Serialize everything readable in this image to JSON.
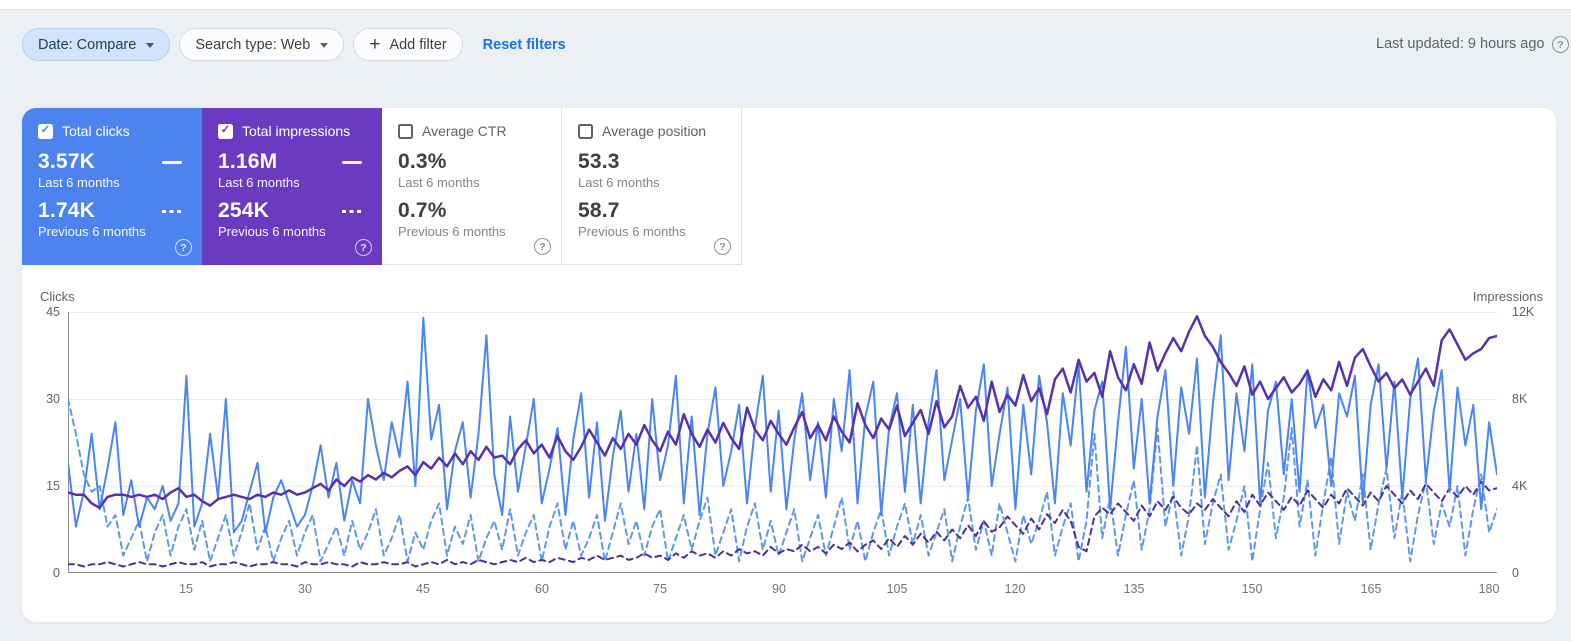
{
  "toolbar": {
    "date_filter": "Date: Compare",
    "search_type_filter": "Search type: Web",
    "add_filter_label": "Add filter",
    "reset_filters_label": "Reset filters",
    "last_updated": "Last updated: 9 hours ago",
    "help_icon_glyph": "?"
  },
  "metrics": [
    {
      "label": "Total clicks",
      "checked": true,
      "color": "#4c83ee",
      "current": {
        "value": "3.57K",
        "period": "Last 6 months"
      },
      "previous": {
        "value": "1.74K",
        "period": "Previous 6 months"
      }
    },
    {
      "label": "Total impressions",
      "checked": true,
      "color": "#6a3bc0",
      "current": {
        "value": "1.16M",
        "period": "Last 6 months"
      },
      "previous": {
        "value": "254K",
        "period": "Previous 6 months"
      }
    },
    {
      "label": "Average CTR",
      "checked": false,
      "color": null,
      "current": {
        "value": "0.3%",
        "period": "Last 6 months"
      },
      "previous": {
        "value": "0.7%",
        "period": "Previous 6 months"
      }
    },
    {
      "label": "Average position",
      "checked": false,
      "color": null,
      "current": {
        "value": "53.3",
        "period": "Last 6 months"
      },
      "previous": {
        "value": "58.7",
        "period": "Previous 6 months"
      }
    }
  ],
  "chart_data": {
    "type": "line",
    "x": "day index (last ~182 days, values approximated from pixels)",
    "x_tick_labels": [
      15,
      30,
      45,
      60,
      75,
      90,
      105,
      120,
      135,
      150,
      165,
      180
    ],
    "axes": {
      "left": {
        "label": "Clicks",
        "max": 45,
        "tick_labels": [
          "45",
          "30",
          "15",
          "0"
        ]
      },
      "right": {
        "label": "Impressions",
        "max": 12,
        "unit": "K",
        "tick_labels": [
          "12K",
          "8K",
          "4K",
          "0"
        ]
      }
    },
    "grid": true,
    "series": [
      {
        "name": "Clicks — Last 6 months",
        "axis": "left",
        "style": "solid",
        "color": "#4a85f0",
        "width": 2,
        "values": [
          19,
          8,
          14,
          24,
          11,
          18,
          26,
          10,
          16,
          8,
          13,
          11,
          15,
          9,
          12,
          34,
          8,
          12,
          24,
          13,
          30,
          7,
          9,
          14,
          19,
          7,
          13,
          16,
          12,
          8,
          10,
          15,
          22,
          13,
          19,
          9,
          16,
          12,
          30,
          22,
          16,
          26,
          20,
          33,
          15,
          44,
          23,
          29,
          11,
          21,
          26,
          13,
          24,
          41,
          17,
          10,
          27,
          14,
          22,
          30,
          12,
          18,
          25,
          10,
          23,
          31,
          13,
          26,
          9,
          20,
          28,
          14,
          24,
          11,
          30,
          16,
          22,
          34,
          12,
          27,
          10,
          24,
          32,
          15,
          21,
          29,
          12,
          25,
          34,
          14,
          28,
          11,
          23,
          31,
          16,
          26,
          13,
          30,
          21,
          35,
          12,
          27,
          33,
          10,
          25,
          31,
          14,
          29,
          12,
          26,
          35,
          16,
          23,
          30,
          13,
          28,
          36,
          15,
          24,
          32,
          11,
          29,
          17,
          34,
          26,
          12,
          31,
          22,
          36,
          14,
          28,
          33,
          11,
          26,
          39,
          18,
          30,
          12,
          27,
          35,
          15,
          32,
          24,
          37,
          13,
          29,
          41,
          16,
          31,
          21,
          36,
          12,
          28,
          33,
          17,
          30,
          14,
          35,
          25,
          29,
          15,
          31,
          27,
          34,
          12,
          29,
          36,
          18,
          33,
          13,
          30,
          37,
          16,
          28,
          35,
          14,
          32,
          22,
          29,
          11,
          26,
          17
        ]
      },
      {
        "name": "Clicks — Previous 6 months",
        "axis": "left",
        "style": "dashed",
        "color": "#5e97ee",
        "width": 2,
        "values": [
          30,
          24,
          17,
          14,
          15,
          8,
          10,
          3,
          6,
          9,
          2,
          7,
          10,
          3,
          8,
          11,
          4,
          9,
          2,
          6,
          10,
          3,
          7,
          12,
          4,
          8,
          2,
          6,
          9,
          3,
          7,
          10,
          2,
          5,
          8,
          3,
          9,
          4,
          7,
          11,
          3,
          6,
          10,
          2,
          7,
          4,
          9,
          12,
          3,
          8,
          5,
          10,
          2,
          6,
          9,
          4,
          11,
          3,
          7,
          10,
          2,
          8,
          12,
          4,
          9,
          3,
          6,
          10,
          2,
          7,
          12,
          5,
          9,
          3,
          8,
          11,
          2,
          6,
          10,
          4,
          9,
          13,
          3,
          7,
          11,
          2,
          8,
          12,
          4,
          9,
          3,
          7,
          11,
          2,
          6,
          10,
          3,
          8,
          13,
          4,
          9,
          2,
          7,
          11,
          3,
          8,
          12,
          5,
          10,
          3,
          7,
          11,
          2,
          8,
          13,
          4,
          9,
          3,
          12,
          7,
          2,
          10,
          5,
          9,
          14,
          3,
          8,
          12,
          2,
          9,
          24,
          6,
          13,
          3,
          10,
          16,
          4,
          11,
          25,
          8,
          14,
          3,
          10,
          22,
          5,
          12,
          17,
          4,
          9,
          15,
          2,
          11,
          19,
          6,
          13,
          25,
          8,
          16,
          3,
          12,
          20,
          5,
          14,
          9,
          17,
          4,
          12,
          18,
          6,
          14,
          2,
          10,
          16,
          5,
          12,
          8,
          15,
          3,
          11,
          17,
          7,
          11
        ]
      },
      {
        "name": "Impressions — Last 6 months",
        "axis": "right",
        "style": "solid",
        "color": "#5732af",
        "width": 2.5,
        "values": [
          3.7,
          3.6,
          3.6,
          3.2,
          3.0,
          3.5,
          3.6,
          3.6,
          3.5,
          3.6,
          3.5,
          3.6,
          3.4,
          3.7,
          3.9,
          3.5,
          3.6,
          3.3,
          3.1,
          3.4,
          3.5,
          3.6,
          3.5,
          3.4,
          3.6,
          3.5,
          3.7,
          3.6,
          3.8,
          3.6,
          3.7,
          3.9,
          4.1,
          3.8,
          4.3,
          4.0,
          4.4,
          4.2,
          4.5,
          4.3,
          4.6,
          4.4,
          4.7,
          4.9,
          4.5,
          5.1,
          4.8,
          5.3,
          4.9,
          5.5,
          5.0,
          5.6,
          5.2,
          5.8,
          5.3,
          5.4,
          5.0,
          5.7,
          6.1,
          5.5,
          5.9,
          5.3,
          6.3,
          5.6,
          5.2,
          5.8,
          6.6,
          6.0,
          5.4,
          6.2,
          5.7,
          6.4,
          5.9,
          6.8,
          6.1,
          5.6,
          6.5,
          5.9,
          7.3,
          6.4,
          5.8,
          6.6,
          6.0,
          6.9,
          6.2,
          5.7,
          7.6,
          6.6,
          6.1,
          7.0,
          6.4,
          5.9,
          6.7,
          7.4,
          6.2,
          6.8,
          6.1,
          7.2,
          6.5,
          6.0,
          7.8,
          6.8,
          6.2,
          7.1,
          6.6,
          7.7,
          6.3,
          6.9,
          7.5,
          6.4,
          7.9,
          6.7,
          7.2,
          8.6,
          7.6,
          8.1,
          7.0,
          8.8,
          7.4,
          8.2,
          7.7,
          9.1,
          7.9,
          8.5,
          7.3,
          8.9,
          9.4,
          8.3,
          9.8,
          8.8,
          9.2,
          8.1,
          10.2,
          9.0,
          8.4,
          9.6,
          8.7,
          10.6,
          9.3,
          10.1,
          10.8,
          10.2,
          11.1,
          11.8,
          10.9,
          10.4,
          9.7,
          9.2,
          8.6,
          9.5,
          8.2,
          8.8,
          8.0,
          8.5,
          9.0,
          8.3,
          8.7,
          9.3,
          8.1,
          8.9,
          8.4,
          9.7,
          8.6,
          9.9,
          10.3,
          9.5,
          8.8,
          9.2,
          8.5,
          8.9,
          8.2,
          8.8,
          9.4,
          8.6,
          10.7,
          11.2,
          10.5,
          9.8,
          10.1,
          10.3,
          10.8,
          10.9
        ]
      },
      {
        "name": "Impressions — Previous 6 months",
        "axis": "right",
        "style": "dashed",
        "color": "#49309f",
        "width": 2,
        "values": [
          0.4,
          0.4,
          0.3,
          0.4,
          0.4,
          0.5,
          0.4,
          0.3,
          0.4,
          0.5,
          0.4,
          0.4,
          0.3,
          0.4,
          0.5,
          0.4,
          0.4,
          0.5,
          0.3,
          0.4,
          0.4,
          0.5,
          0.4,
          0.3,
          0.4,
          0.4,
          0.5,
          0.4,
          0.4,
          0.3,
          0.5,
          0.4,
          0.4,
          0.5,
          0.4,
          0.4,
          0.3,
          0.5,
          0.4,
          0.4,
          0.5,
          0.4,
          0.4,
          0.5,
          0.3,
          0.4,
          0.5,
          0.4,
          0.6,
          0.4,
          0.5,
          0.4,
          0.6,
          0.5,
          0.4,
          0.5,
          0.6,
          0.5,
          0.7,
          0.5,
          0.6,
          0.5,
          0.7,
          0.6,
          0.5,
          0.7,
          0.6,
          0.8,
          0.6,
          0.7,
          0.8,
          0.6,
          0.7,
          0.9,
          0.7,
          0.8,
          0.6,
          0.9,
          0.7,
          1.0,
          0.8,
          0.9,
          0.7,
          1.0,
          0.8,
          1.1,
          0.9,
          1.0,
          0.8,
          1.2,
          0.9,
          1.1,
          1.0,
          1.3,
          1.0,
          1.2,
          0.9,
          1.3,
          1.1,
          1.4,
          1.0,
          1.3,
          1.5,
          1.1,
          1.6,
          1.2,
          1.7,
          1.3,
          1.8,
          1.4,
          1.9,
          1.5,
          2.0,
          1.6,
          2.2,
          1.7,
          2.4,
          1.9,
          2.1,
          2.6,
          2.2,
          1.8,
          2.5,
          2.0,
          2.7,
          2.3,
          2.9,
          2.4,
          1.2,
          1.0,
          2.6,
          3.0,
          2.7,
          3.2,
          2.8,
          2.4,
          3.1,
          2.6,
          3.3,
          2.9,
          3.5,
          3.0,
          2.7,
          3.2,
          2.9,
          3.4,
          3.0,
          2.6,
          3.3,
          2.8,
          3.6,
          3.1,
          3.7,
          3.3,
          2.9,
          3.5,
          3.1,
          3.8,
          3.4,
          3.0,
          3.6,
          3.2,
          3.9,
          3.5,
          3.1,
          3.7,
          3.3,
          4.0,
          3.6,
          3.2,
          3.8,
          3.4,
          4.1,
          3.7,
          3.3,
          3.9,
          3.5,
          4.0,
          3.6,
          4.2,
          3.8,
          3.9
        ]
      }
    ]
  }
}
